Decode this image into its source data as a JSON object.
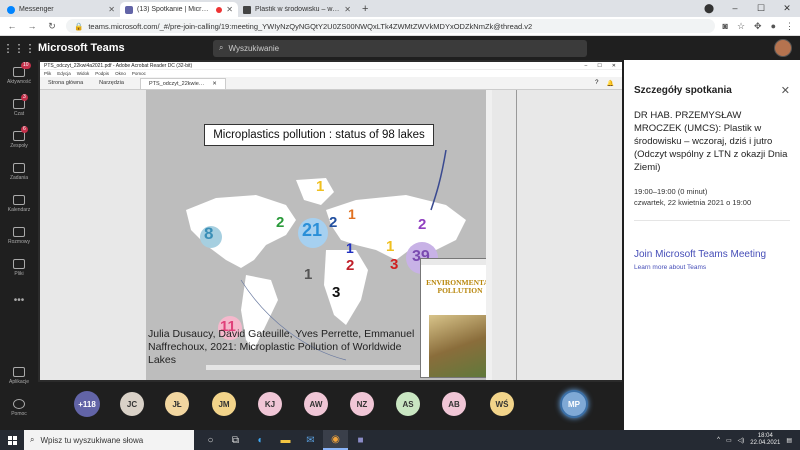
{
  "browser": {
    "tabs": [
      {
        "title": "Messenger",
        "color": "#0084ff"
      },
      {
        "title": "(13) Spotkanie | Microsoft Teams",
        "color": "#6264a7",
        "active": true
      },
      {
        "title": "Plastik w środowisku – wczoraj, dz…",
        "color": "#444444"
      }
    ],
    "new_tab": "+",
    "url": "teams.microsoft.com/_#/pre-join-calling/19:meeting_YWIyNzQyNGQtY2U0ZS00NWQxLTk4ZWMtZWVkMDYxODZkNmZk@thread.v2"
  },
  "teams": {
    "app_title": "Microsoft Teams",
    "search_placeholder": "Wyszukiwanie",
    "rail": [
      {
        "label": "Aktywność",
        "badge": "10"
      },
      {
        "label": "Czat",
        "badge": "3"
      },
      {
        "label": "Zespoły",
        "badge": "6"
      },
      {
        "label": "Zadania",
        "badge": ""
      },
      {
        "label": "Kalendarz",
        "badge": ""
      },
      {
        "label": "Rozmowy",
        "badge": ""
      },
      {
        "label": "Pliki",
        "badge": ""
      }
    ],
    "rail_more": "•••",
    "rail_bottom": [
      {
        "label": "Aplikacje"
      },
      {
        "label": "Pomoc"
      }
    ]
  },
  "acrobat": {
    "window_title": "PTS_odczyt_22kwi4a2021.pdf - Adobe Acrobat Reader DC (32-bit)",
    "menu": [
      "Plik",
      "Edycja",
      "Widok",
      "Podpis",
      "Okno",
      "Pomoc"
    ],
    "tabs": {
      "home": "Strona główna",
      "tools": "Narzędzia",
      "doc": "PTS_odczyt_22kwie…"
    }
  },
  "slide": {
    "title": "Microplastics pollution : status of 98 lakes",
    "credits_line1": "Julia Dusaucy, David Gateuille, Yves Perrette, Emmanuel",
    "credits_line2": "Naffrechoux, 2021: Microplastic Pollution of Worldwide Lakes",
    "journal_title_1": "ENVIRONMENTAL",
    "journal_title_2": "POLLUTION",
    "lakes": [
      {
        "n": "8",
        "color": "#3a8fb7"
      },
      {
        "n": "21",
        "color": "#2a8fd8"
      },
      {
        "n": "2",
        "color": "#2a9a3a"
      },
      {
        "n": "2",
        "color": "#2250a0"
      },
      {
        "n": "1",
        "color": "#f0c020"
      },
      {
        "n": "1",
        "color": "#e07020"
      },
      {
        "n": "1",
        "color": "#2030c0"
      },
      {
        "n": "2",
        "color": "#c0202a"
      },
      {
        "n": "1",
        "color": "#f0c020"
      },
      {
        "n": "3",
        "color": "#d02020"
      },
      {
        "n": "2",
        "color": "#9040c0"
      },
      {
        "n": "39",
        "color": "#7a4ab0"
      },
      {
        "n": "1",
        "color": "#555555"
      },
      {
        "n": "3",
        "color": "#111111"
      },
      {
        "n": "11",
        "color": "#e0407a"
      }
    ]
  },
  "panel": {
    "title": "Szczegóły spotkania",
    "description": "DR HAB. PRZEMYSŁAW MROCZEK (UMCS): Plastik w środowisku – wczoraj, dziś i jutro (Odczyt wspólny z LTN z okazji Dnia Ziemi)",
    "time": "19:00–19:00 (0 minut)",
    "date": "czwartek, 22 kwietnia 2021 o 19:00",
    "join_link": "Join Microsoft Teams Meeting",
    "learn_link": "Learn more about Teams"
  },
  "participants": {
    "more_count": "+118",
    "people": [
      {
        "initials": "JC",
        "color": "#d9d1c7"
      },
      {
        "initials": "JŁ",
        "color": "#f2d6a0"
      },
      {
        "initials": "JM",
        "color": "#f2d48a"
      },
      {
        "initials": "KJ",
        "color": "#f0c6d6"
      },
      {
        "initials": "AW",
        "color": "#f0c6d6"
      },
      {
        "initials": "NZ",
        "color": "#f0c6d6"
      },
      {
        "initials": "AS",
        "color": "#c9e6c2"
      },
      {
        "initials": "AB",
        "color": "#f0c6d6"
      },
      {
        "initials": "WŚ",
        "color": "#f2d48a"
      }
    ],
    "me": "MP"
  },
  "taskbar": {
    "search_placeholder": "Wpisz tu wyszukiwane słowa",
    "time": "18:04",
    "date": "22.04.2021"
  }
}
